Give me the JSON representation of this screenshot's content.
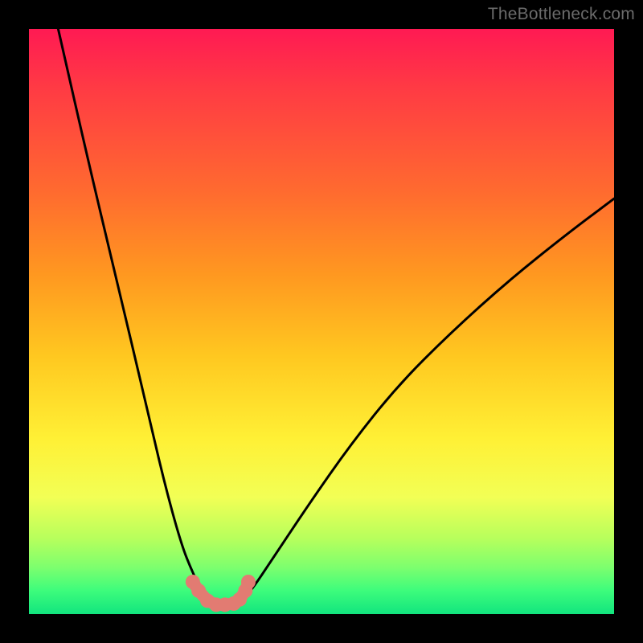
{
  "watermark": "TheBottleneck.com",
  "chart_data": {
    "type": "line",
    "title": "",
    "xlabel": "",
    "ylabel": "",
    "xlim": [
      0,
      100
    ],
    "ylim": [
      0,
      100
    ],
    "series": [
      {
        "name": "curve",
        "x": [
          5,
          10,
          15,
          20,
          23,
          26,
          28,
          30,
          31,
          32,
          33,
          34,
          35,
          36,
          38,
          42,
          48,
          55,
          63,
          72,
          82,
          92,
          100
        ],
        "y": [
          100,
          78,
          57,
          36,
          23,
          12,
          7,
          3,
          2,
          1.5,
          1.3,
          1.3,
          1.5,
          2,
          4,
          10,
          19,
          29,
          39,
          48,
          57,
          65,
          71
        ]
      },
      {
        "name": "markers",
        "x": [
          28,
          29,
          30.5,
          32,
          33.5,
          35,
          36,
          37,
          37.5
        ],
        "y": [
          5.5,
          4.0,
          2.3,
          1.6,
          1.6,
          1.8,
          2.5,
          4.0,
          5.5
        ]
      }
    ],
    "colors": {
      "curve": "#000000",
      "marker": "#e27b72",
      "background_gradient": [
        "#ff1a53",
        "#12e57e"
      ]
    }
  }
}
